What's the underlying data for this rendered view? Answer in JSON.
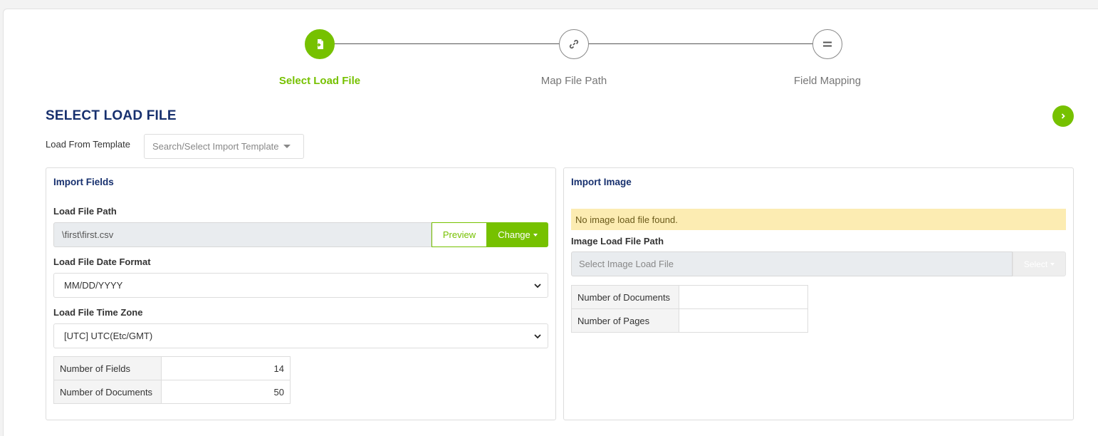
{
  "stepper": {
    "steps": [
      {
        "label": "Select Load File",
        "icon": "file-import-icon",
        "active": true
      },
      {
        "label": "Map File Path",
        "icon": "link-icon",
        "active": false
      },
      {
        "label": "Field Mapping",
        "icon": "equals-icon",
        "active": false
      }
    ]
  },
  "page": {
    "title": "SELECT LOAD FILE",
    "next_icon": "chevron-right-icon"
  },
  "template": {
    "label": "Load From Template",
    "placeholder": "Search/Select Import Template"
  },
  "import_fields": {
    "title": "Import Fields",
    "load_file_path_label": "Load File Path",
    "load_file_path_value": "\\first\\first.csv",
    "preview_label": "Preview",
    "change_label": "Change",
    "date_format_label": "Load File Date Format",
    "date_format_value": "MM/DD/YYYY",
    "time_zone_label": "Load File Time Zone",
    "time_zone_value": "[UTC] UTC(Etc/GMT)",
    "stats": [
      {
        "label": "Number of Fields",
        "value": "14"
      },
      {
        "label": "Number of Documents",
        "value": "50"
      }
    ]
  },
  "import_image": {
    "title": "Import Image",
    "alert": "No image load file found.",
    "path_label": "Image Load File Path",
    "path_placeholder": "Select Image Load File",
    "select_label": "Select",
    "stats": [
      {
        "label": "Number of Documents",
        "value": ""
      },
      {
        "label": "Number of Pages",
        "value": ""
      }
    ]
  },
  "colors": {
    "accent": "#76c100",
    "title": "#17306e",
    "alert_bg": "#fcecb2"
  }
}
